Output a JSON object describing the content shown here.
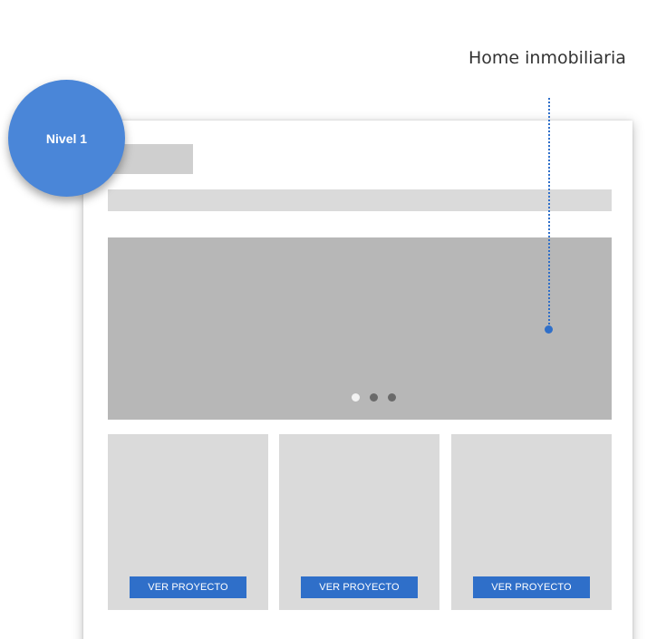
{
  "badge": {
    "label": "Nivel 1",
    "color": "#4a86d8"
  },
  "annotation": {
    "label": "Home inmobiliaria",
    "color": "#2f6fc9"
  },
  "slider": {
    "dot_count": 3,
    "active_index": 0
  },
  "cards": [
    {
      "button_label": "VER PROYECTO"
    },
    {
      "button_label": "VER PROYECTO"
    },
    {
      "button_label": "VER PROYECTO"
    }
  ],
  "colors": {
    "accent": "#2f6fc9",
    "placeholder_light": "#dadada",
    "placeholder_dark": "#b7b7b7"
  }
}
